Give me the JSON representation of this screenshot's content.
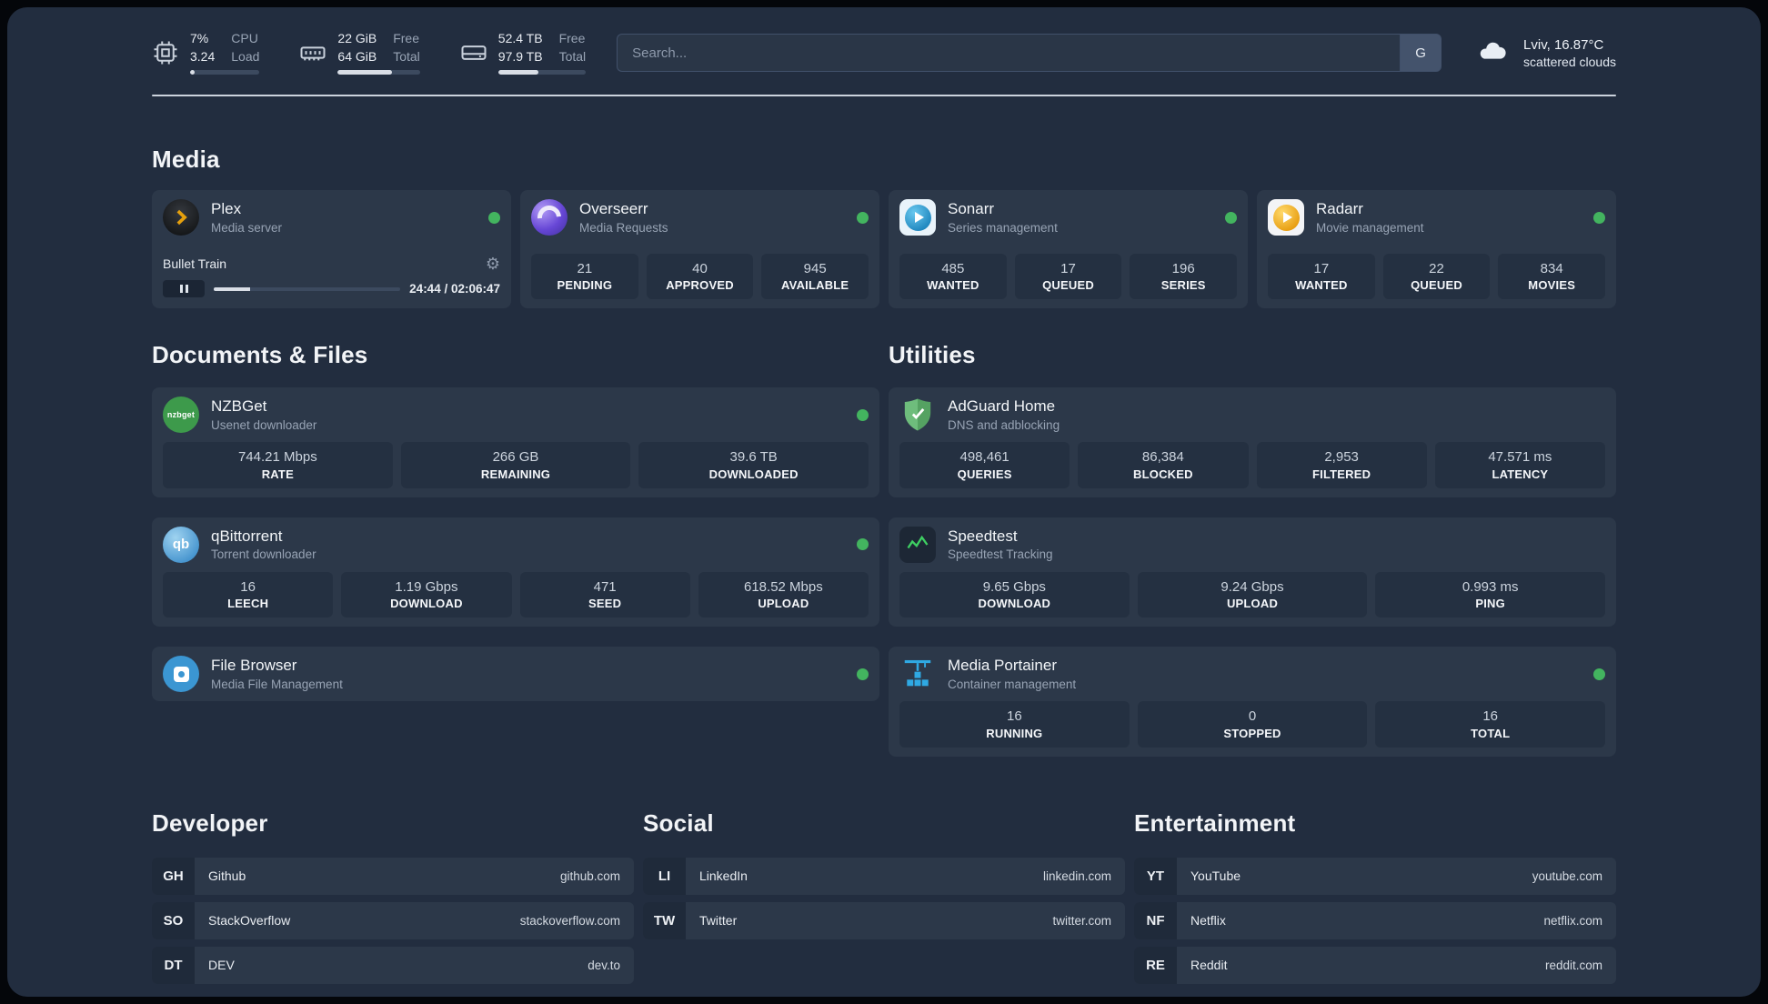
{
  "topbar": {
    "cpu": {
      "value1": "7%",
      "value2": "3.24",
      "label1": "CPU",
      "label2": "Load",
      "bar": 7
    },
    "memory": {
      "value1": "22 GiB",
      "value2": "64 GiB",
      "label1": "Free",
      "label2": "Total",
      "bar": 66
    },
    "disk": {
      "value1": "52.4 TB",
      "value2": "97.9 TB",
      "label1": "Free",
      "label2": "Total",
      "bar": 46
    },
    "search": {
      "placeholder": "Search...",
      "button_label": "G"
    },
    "weather": {
      "location": "Lviv, 16.87°C",
      "condition": "scattered clouds"
    }
  },
  "sections": {
    "media": {
      "title": "Media",
      "plex": {
        "name": "Plex",
        "subtitle": "Media server",
        "now_playing": "Bullet Train",
        "time": "24:44 / 02:06:47",
        "progress": 19.5
      },
      "overseerr": {
        "name": "Overseerr",
        "subtitle": "Media Requests",
        "stats": [
          {
            "value": "21",
            "label": "PENDING"
          },
          {
            "value": "40",
            "label": "APPROVED"
          },
          {
            "value": "945",
            "label": "AVAILABLE"
          }
        ]
      },
      "sonarr": {
        "name": "Sonarr",
        "subtitle": "Series management",
        "stats": [
          {
            "value": "485",
            "label": "WANTED"
          },
          {
            "value": "17",
            "label": "QUEUED"
          },
          {
            "value": "196",
            "label": "SERIES"
          }
        ]
      },
      "radarr": {
        "name": "Radarr",
        "subtitle": "Movie management",
        "stats": [
          {
            "value": "17",
            "label": "WANTED"
          },
          {
            "value": "22",
            "label": "QUEUED"
          },
          {
            "value": "834",
            "label": "MOVIES"
          }
        ]
      }
    },
    "documents": {
      "title": "Documents & Files",
      "nzbget": {
        "name": "NZBGet",
        "subtitle": "Usenet downloader",
        "icon_text": "nzbget",
        "stats": [
          {
            "value": "744.21 Mbps",
            "label": "RATE"
          },
          {
            "value": "266 GB",
            "label": "REMAINING"
          },
          {
            "value": "39.6 TB",
            "label": "DOWNLOADED"
          }
        ]
      },
      "qbittorrent": {
        "name": "qBittorrent",
        "subtitle": "Torrent downloader",
        "icon_text": "qb",
        "stats": [
          {
            "value": "16",
            "label": "LEECH"
          },
          {
            "value": "1.19 Gbps",
            "label": "DOWNLOAD"
          },
          {
            "value": "471",
            "label": "SEED"
          },
          {
            "value": "618.52 Mbps",
            "label": "UPLOAD"
          }
        ]
      },
      "filebrowser": {
        "name": "File Browser",
        "subtitle": "Media File Management"
      }
    },
    "utilities": {
      "title": "Utilities",
      "adguard": {
        "name": "AdGuard Home",
        "subtitle": "DNS and adblocking",
        "stats": [
          {
            "value": "498,461",
            "label": "QUERIES"
          },
          {
            "value": "86,384",
            "label": "BLOCKED"
          },
          {
            "value": "2,953",
            "label": "FILTERED"
          },
          {
            "value": "47.571 ms",
            "label": "LATENCY"
          }
        ]
      },
      "speedtest": {
        "name": "Speedtest",
        "subtitle": "Speedtest Tracking",
        "stats": [
          {
            "value": "9.65 Gbps",
            "label": "DOWNLOAD"
          },
          {
            "value": "9.24 Gbps",
            "label": "UPLOAD"
          },
          {
            "value": "0.993 ms",
            "label": "PING"
          }
        ]
      },
      "portainer": {
        "name": "Media Portainer",
        "subtitle": "Container management",
        "stats": [
          {
            "value": "16",
            "label": "RUNNING"
          },
          {
            "value": "0",
            "label": "STOPPED"
          },
          {
            "value": "16",
            "label": "TOTAL"
          }
        ]
      }
    },
    "bookmarks": {
      "developer": {
        "title": "Developer",
        "items": [
          {
            "abbr": "GH",
            "name": "Github",
            "url": "github.com"
          },
          {
            "abbr": "SO",
            "name": "StackOverflow",
            "url": "stackoverflow.com"
          },
          {
            "abbr": "DT",
            "name": "DEV",
            "url": "dev.to"
          }
        ]
      },
      "social": {
        "title": "Social",
        "items": [
          {
            "abbr": "LI",
            "name": "LinkedIn",
            "url": "linkedin.com"
          },
          {
            "abbr": "TW",
            "name": "Twitter",
            "url": "twitter.com"
          }
        ]
      },
      "entertainment": {
        "title": "Entertainment",
        "items": [
          {
            "abbr": "YT",
            "name": "YouTube",
            "url": "youtube.com"
          },
          {
            "abbr": "NF",
            "name": "Netflix",
            "url": "netflix.com"
          },
          {
            "abbr": "RE",
            "name": "Reddit",
            "url": "reddit.com"
          }
        ]
      }
    }
  },
  "colors": {
    "background": "#222d3f",
    "card": "#2c3849",
    "stat_box": "#243041",
    "status_online": "#43b45f",
    "plex_accent": "#e5a00d",
    "sonarr_accent": "#1d85bd",
    "radarr_accent": "#e79c0e",
    "overseerr_accent": "#6747d6",
    "nzbget_accent": "#3d9a4b",
    "qbittorrent_accent": "#4795cf",
    "filebrowser_accent": "#3b96d2",
    "adguard_accent": "#5fae6d",
    "portainer_accent": "#2fa9e3",
    "speedtest_accent": "#3ecf62"
  }
}
